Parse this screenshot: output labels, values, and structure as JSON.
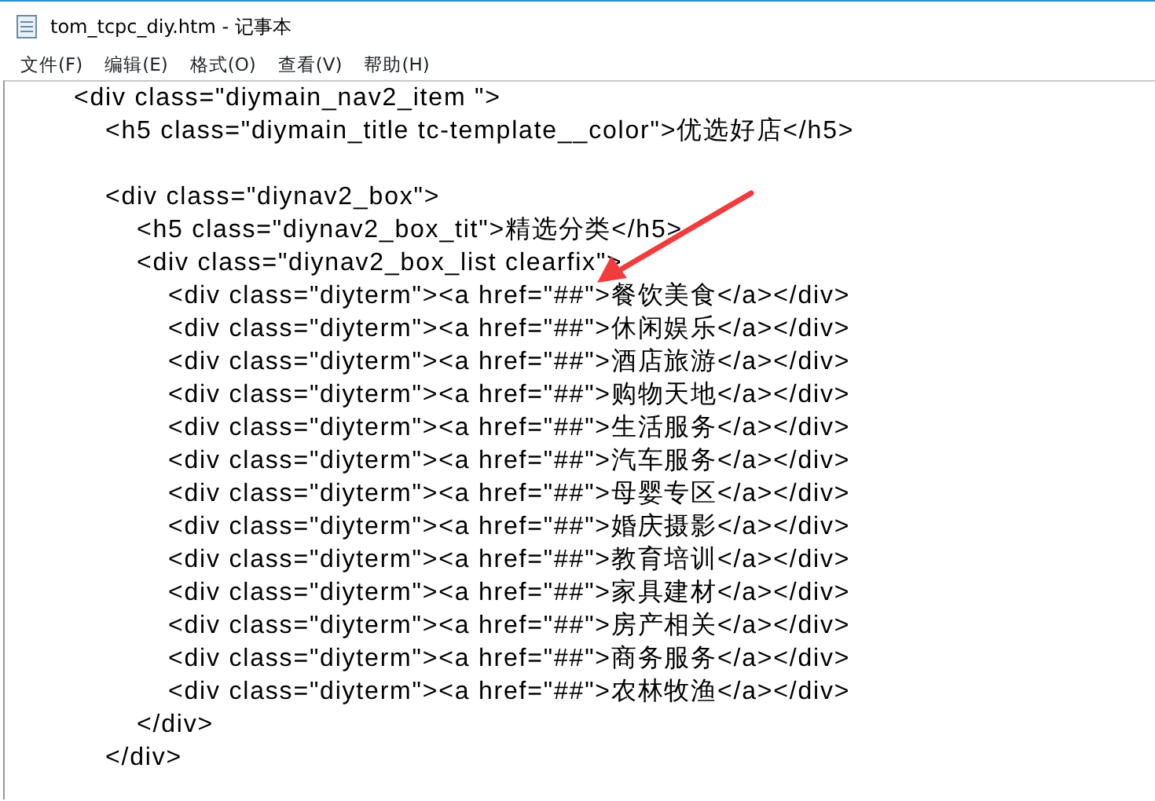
{
  "window": {
    "title": "tom_tcpc_diy.htm - 记事本"
  },
  "menu": [
    "文件(F)",
    "编辑(E)",
    "格式(O)",
    "查看(V)",
    "帮助(H)"
  ],
  "lines": [
    {
      "kind": "code",
      "text": "<div class=\"diymain_nav2_item \">",
      "children": [
        {
          "kind": "code",
          "text": "<h5 class=\"diymain_title tc-template__color\">优选好店</h5>"
        },
        {
          "kind": "blank"
        },
        {
          "kind": "code",
          "text": "<div class=\"diynav2_box\">",
          "children": [
            {
              "kind": "code",
              "text": "<h5 class=\"diynav2_box_tit\">精选分类</h5>"
            },
            {
              "kind": "code",
              "text": "<div class=\"diynav2_box_list clearfix\">",
              "children": [
                {
                  "kind": "code",
                  "text": "<div class=\"diyterm\"><a href=\"##\">餐饮美食</a></div>"
                },
                {
                  "kind": "code",
                  "text": "<div class=\"diyterm\"><a href=\"##\">休闲娱乐</a></div>"
                },
                {
                  "kind": "code",
                  "text": "<div class=\"diyterm\"><a href=\"##\">酒店旅游</a></div>"
                },
                {
                  "kind": "code",
                  "text": "<div class=\"diyterm\"><a href=\"##\">购物天地</a></div>"
                },
                {
                  "kind": "code",
                  "text": "<div class=\"diyterm\"><a href=\"##\">生活服务</a></div>"
                },
                {
                  "kind": "code",
                  "text": "<div class=\"diyterm\"><a href=\"##\">汽车服务</a></div>"
                },
                {
                  "kind": "code",
                  "text": "<div class=\"diyterm\"><a href=\"##\">母婴专区</a></div>"
                },
                {
                  "kind": "code",
                  "text": "<div class=\"diyterm\"><a href=\"##\">婚庆摄影</a></div>"
                },
                {
                  "kind": "code",
                  "text": "<div class=\"diyterm\"><a href=\"##\">教育培训</a></div>"
                },
                {
                  "kind": "code",
                  "text": "<div class=\"diyterm\"><a href=\"##\">家具建材</a></div>"
                },
                {
                  "kind": "code",
                  "text": "<div class=\"diyterm\"><a href=\"##\">房产相关</a></div>"
                },
                {
                  "kind": "code",
                  "text": "<div class=\"diyterm\"><a href=\"##\">商务服务</a></div>"
                },
                {
                  "kind": "code",
                  "text": "<div class=\"diyterm\"><a href=\"##\">农林牧渔</a></div>"
                }
              ]
            },
            {
              "kind": "code",
              "text": "</div>"
            }
          ]
        },
        {
          "kind": "code",
          "text": "</div>"
        }
      ]
    }
  ]
}
